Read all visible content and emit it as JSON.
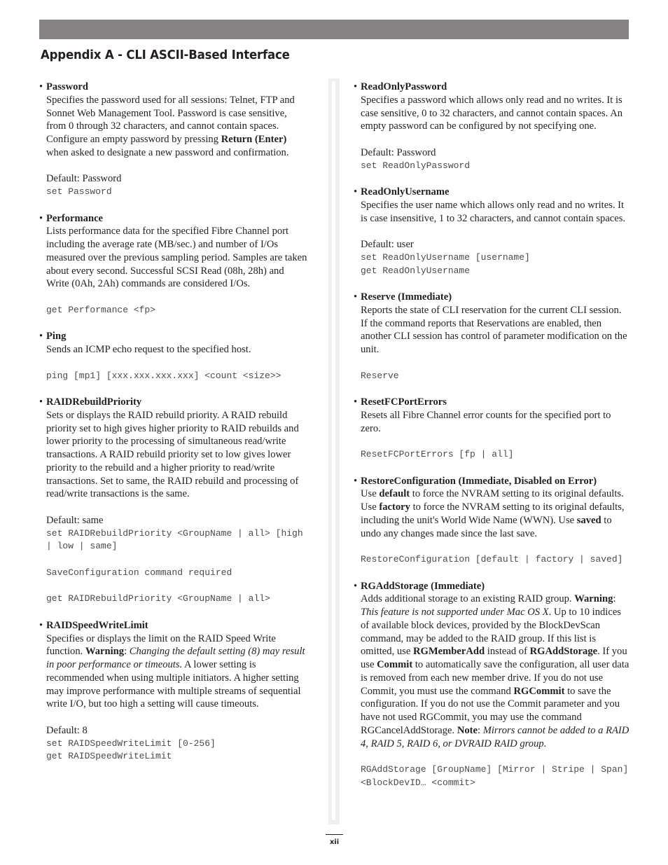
{
  "header": {
    "title": "Appendix A - CLI ASCII-Based Interface",
    "bar_color": "#848283"
  },
  "left_column": [
    {
      "title": "Password",
      "description_parts": [
        {
          "t": "Specifies the password used for all sessions: Telnet, FTP and Sonnet Web Management Tool. Password is case sensitive, from 0 through 32 characters, and cannot contain spaces. Configure an empty password by pressing "
        },
        {
          "t": "Return (Enter)",
          "b": true
        },
        {
          "t": " when asked to designate a new password and confirmation."
        }
      ],
      "default": "Default: Password",
      "code_blocks": [
        [
          "set Password"
        ]
      ]
    },
    {
      "title": "Performance",
      "description_parts": [
        {
          "t": "Lists performance data for the specified Fibre Channel port including the average rate (MB/sec.) and number of I/Os measured over the previous sampling period. Samples are taken about every second. Successful SCSI Read (08h, 28h) and Write (0Ah, 2Ah) commands are considered I/Os."
        }
      ],
      "default": "",
      "code_blocks": [
        [
          "get Performance <fp>"
        ]
      ]
    },
    {
      "title": "Ping",
      "description_parts": [
        {
          "t": "Sends an ICMP echo request to the specified host."
        }
      ],
      "default": "",
      "code_blocks": [
        [
          "ping [mp1] [xxx.xxx.xxx.xxx] <count <size>>"
        ]
      ]
    },
    {
      "title": "RAIDRebuildPriority",
      "description_parts": [
        {
          "t": "Sets or displays the RAID rebuild priority. A RAID rebuild priority set to high gives higher priority to RAID rebuilds and lower priority to the processing of simultaneous read/write transactions. A RAID rebuild priority set to low gives lower priority to the rebuild and a higher priority to read/write transactions. Set to same, the RAID rebuild and processing of read/write transactions is the same."
        }
      ],
      "default": "Default: same",
      "code_blocks": [
        [
          "set RAIDRebuildPriority <GroupName | all> [high | low | same]"
        ],
        [
          "SaveConfiguration command required"
        ],
        [
          "get RAIDRebuildPriority <GroupName | all>"
        ]
      ]
    },
    {
      "title": "RAIDSpeedWriteLimit",
      "description_parts": [
        {
          "t": "Specifies or displays the limit on the RAID Speed Write function. "
        },
        {
          "t": "Warning",
          "b": true
        },
        {
          "t": ": "
        },
        {
          "t": "Changing the default setting (8) may result in poor performance or timeouts.",
          "i": true
        },
        {
          "t": " A lower setting is recommended when using multiple initiators. A higher setting may improve performance with multiple streams of sequential write I/O, but too high a setting will cause timeouts."
        }
      ],
      "default": "Default: 8",
      "code_blocks": [
        [
          "set RAIDSpeedWriteLimit [0-256]",
          "get RAIDSpeedWriteLimit"
        ]
      ]
    }
  ],
  "right_column": [
    {
      "title": "ReadOnlyPassword",
      "description_parts": [
        {
          "t": "Specifies a password which allows only read and no writes. It is case sensitive, 0 to 32 characters, and cannot contain spaces. An empty password can be configured by not specifying one."
        }
      ],
      "default": "Default: Password",
      "code_blocks": [
        [
          "set ReadOnlyPassword"
        ]
      ]
    },
    {
      "title": "ReadOnlyUsername",
      "description_parts": [
        {
          "t": "Specifies the user name which allows only read and no writes. It is case insensitive, 1 to 32 characters, and cannot contain spaces."
        }
      ],
      "default": "Default: user",
      "code_blocks": [
        [
          "set ReadOnlyUsername [username]",
          "get ReadOnlyUsername"
        ]
      ]
    },
    {
      "title": "Reserve (Immediate)",
      "description_parts": [
        {
          "t": "Reports the state of CLI reservation for the current CLI session. If the command reports that Reservations are enabled, then another CLI session has control of parameter modification on the unit."
        }
      ],
      "default": "",
      "code_blocks": [
        [
          "Reserve"
        ]
      ]
    },
    {
      "title": "ResetFCPortErrors",
      "description_parts": [
        {
          "t": "Resets all Fibre Channel error counts for the specified port to zero."
        }
      ],
      "default": "",
      "code_blocks": [
        [
          "ResetFCPortErrors [fp | all]"
        ]
      ]
    },
    {
      "title": "RestoreConfiguration (Immediate, Disabled on Error)",
      "description_parts": [
        {
          "t": "Use "
        },
        {
          "t": "default",
          "b": true
        },
        {
          "t": " to force the NVRAM setting to its original defaults. Use "
        },
        {
          "t": "factory",
          "b": true
        },
        {
          "t": " to force the NVRAM setting to its original defaults, including the unit's World Wide Name (WWN). Use "
        },
        {
          "t": "saved",
          "b": true
        },
        {
          "t": " to undo any changes made since the last save."
        }
      ],
      "default": "",
      "code_blocks": [
        [
          "RestoreConfiguration [default | factory | saved]"
        ]
      ]
    },
    {
      "title": "RGAddStorage (Immediate)",
      "description_parts": [
        {
          "t": "Adds additional storage to an existing RAID group. "
        },
        {
          "t": "Warning",
          "b": true
        },
        {
          "t": ": "
        },
        {
          "t": "This feature is not supported under Mac OS X",
          "i": true
        },
        {
          "t": ". Up to 10 indices of available block devices, provided by the BlockDevScan command, may be added to the RAID group. If this list is omitted, use "
        },
        {
          "t": "RGMemberAdd",
          "b": true
        },
        {
          "t": " instead of "
        },
        {
          "t": "RGAddStorage",
          "b": true
        },
        {
          "t": ". If you use "
        },
        {
          "t": "Commit",
          "b": true
        },
        {
          "t": " to automatically save the configuration, all user data is removed from each new member drive. If you do not use Commit, you must use the command "
        },
        {
          "t": "RGCommit",
          "b": true
        },
        {
          "t": " to save the configuration. If you do not use the Commit parameter and you have not used RGCommit, you may use the command RGCancelAddStorage. "
        },
        {
          "t": "Note",
          "b": true
        },
        {
          "t": ": "
        },
        {
          "t": "Mirrors cannot be added to a RAID 4, RAID 5, RAID 6, or DVRAID RAID group.",
          "i": true
        }
      ],
      "default": "",
      "code_blocks": [
        [
          "RGAddStorage [GroupName] [Mirror | Stripe | Span] <BlockDevID… <commit>"
        ]
      ]
    }
  ],
  "footer": {
    "page_number": "xii"
  }
}
